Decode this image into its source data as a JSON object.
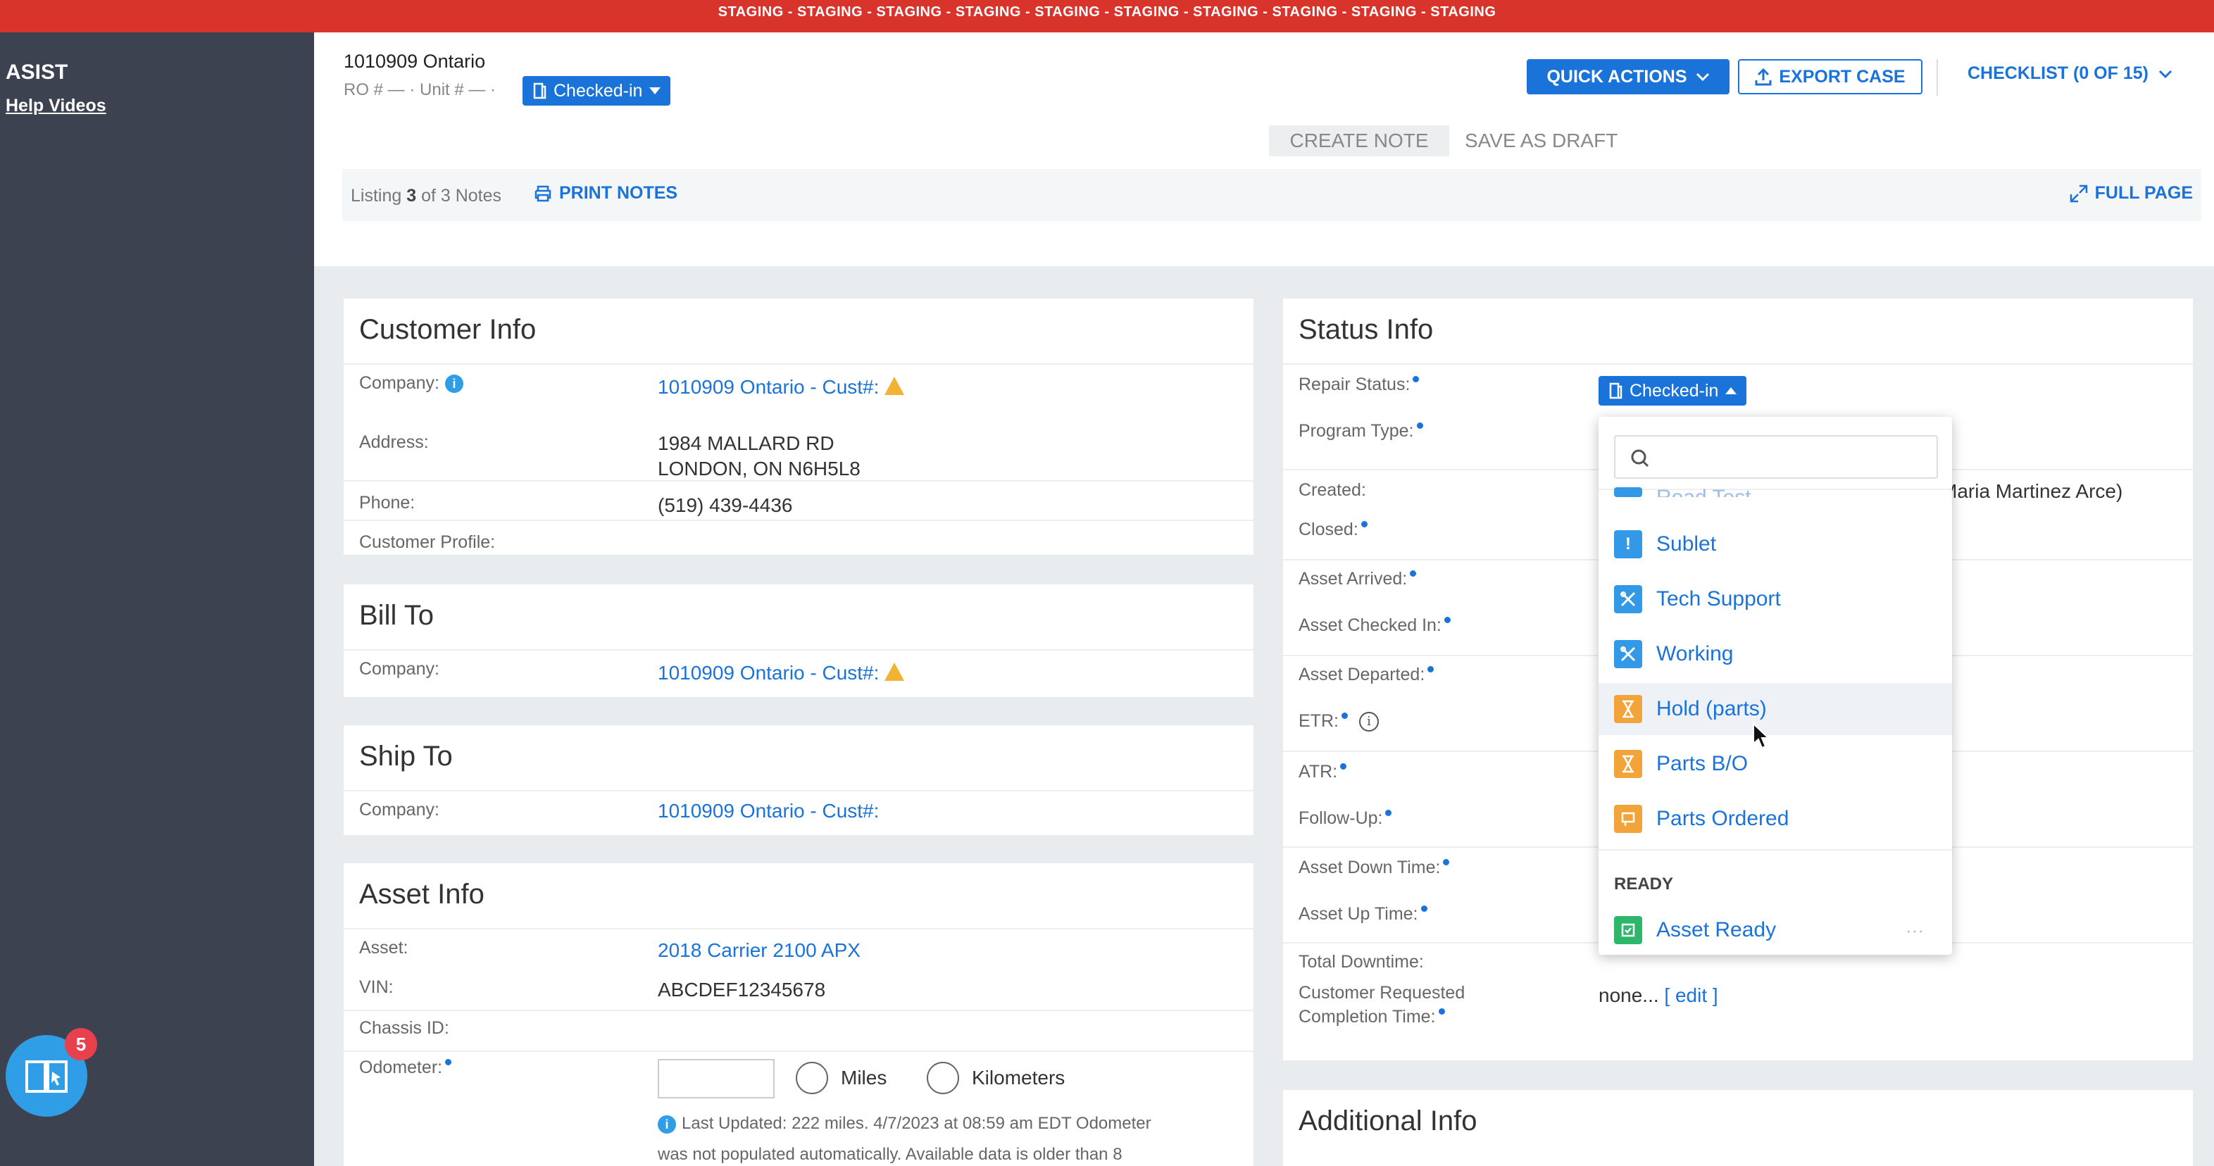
{
  "banner": {
    "text": "STAGING - STAGING - STAGING - STAGING - STAGING - STAGING - STAGING - STAGING - STAGING - STAGING"
  },
  "sidebar": {
    "title": "ASIST",
    "help_link": "Help Videos",
    "help_badge": "5"
  },
  "header": {
    "title": "1010909 Ontario",
    "subtitle": "RO # — · Unit # — ·",
    "status_pill": "Checked-in",
    "quick_actions": "QUICK ACTIONS",
    "export_case": "EXPORT CASE",
    "checklist": "CHECKLIST (0 OF 15)"
  },
  "notes": {
    "create_note": "CREATE NOTE",
    "save_draft": "SAVE AS DRAFT",
    "listing_prefix": "Listing ",
    "listing_count": "3",
    "listing_suffix": " of 3 Notes",
    "print_notes": "PRINT NOTES",
    "full_page": "FULL PAGE"
  },
  "customer_info": {
    "title": "Customer Info",
    "company_label": "Company:",
    "company_value": "1010909 Ontario - Cust#:",
    "address_label": "Address:",
    "address_line1": "1984 MALLARD RD",
    "address_line2": "LONDON, ON N6H5L8",
    "phone_label": "Phone:",
    "phone_value": "(519) 439-4436",
    "profile_label": "Customer Profile:"
  },
  "bill_to": {
    "title": "Bill To",
    "company_label": "Company:",
    "company_value": "1010909 Ontario - Cust#:"
  },
  "ship_to": {
    "title": "Ship To",
    "company_label": "Company:",
    "company_value": "1010909 Ontario - Cust#:"
  },
  "asset_info": {
    "title": "Asset Info",
    "asset_label": "Asset:",
    "asset_value": "2018 Carrier 2100 APX",
    "vin_label": "VIN:",
    "vin_value": "ABCDEF12345678",
    "chassis_label": "Chassis ID:",
    "odometer_label": "Odometer:",
    "miles": "Miles",
    "kilometers": "Kilometers",
    "odometer_note_1": "Last Updated: 222 miles. 4/7/2023 at 08:59 am EDT Odometer",
    "odometer_note_2": "was not populated automatically. Available data is older than 8"
  },
  "status_info": {
    "title": "Status Info",
    "repair_status_label": "Repair Status:",
    "repair_status_value": "Checked-in",
    "program_type_label": "Program Type:",
    "created_label": "Created:",
    "created_value_partial": "Maria Martinez Arce)",
    "closed_label": "Closed:",
    "asset_arrived_label": "Asset Arrived:",
    "asset_checked_in_label": "Asset Checked In:",
    "asset_departed_label": "Asset Departed:",
    "etr_label": "ETR:",
    "atr_label": "ATR:",
    "follow_up_label": "Follow-Up:",
    "asset_down_label": "Asset Down Time:",
    "asset_up_label": "Asset Up Time:",
    "total_downtime_label": "Total Downtime:",
    "crct_label_1": "Customer Requested",
    "crct_label_2": "Completion Time:",
    "crct_value": "none...",
    "crct_edit_open": " [ ",
    "crct_edit": "edit",
    "crct_edit_close": " ]"
  },
  "additional_info": {
    "title": "Additional Info"
  },
  "status_dropdown": {
    "search_placeholder": "",
    "partial_item": "Road Test",
    "items": [
      {
        "label": "Sublet",
        "icon": "exclamation-icon",
        "color": "#3399e6"
      },
      {
        "label": "Tech Support",
        "icon": "tools-icon",
        "color": "#3399e6"
      },
      {
        "label": "Working",
        "icon": "tools-icon",
        "color": "#3399e6"
      },
      {
        "label": "Hold (parts)",
        "icon": "hourglass-icon",
        "color": "#f2a43a"
      },
      {
        "label": "Parts B/O",
        "icon": "hourglass-icon",
        "color": "#f2a43a"
      },
      {
        "label": "Parts Ordered",
        "icon": "parts-icon",
        "color": "#f2a43a"
      }
    ],
    "group_ready": "READY",
    "ready_item": "Asset Ready",
    "more": "···"
  }
}
